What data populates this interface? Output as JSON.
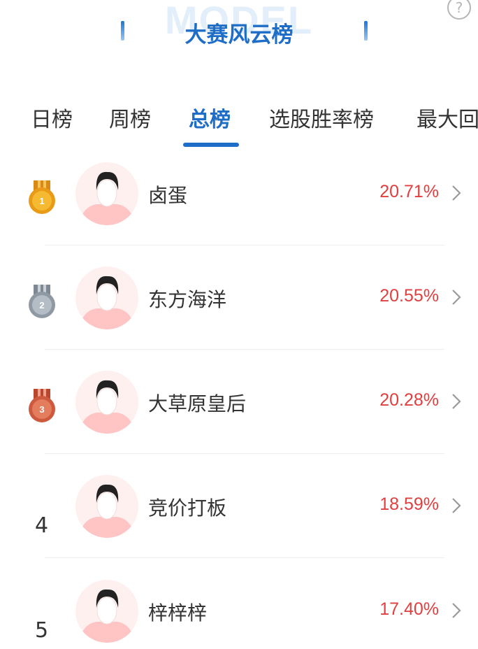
{
  "header": {
    "watermark": "MODEL",
    "title": "大赛风云榜",
    "help_symbol": "?"
  },
  "tabs": [
    {
      "label": "日榜",
      "active": false
    },
    {
      "label": "周榜",
      "active": false
    },
    {
      "label": "总榜",
      "active": true
    },
    {
      "label": "选股胜率榜",
      "active": false
    },
    {
      "label": "最大回",
      "active": false
    }
  ],
  "colors": {
    "accent": "#1e6dc7",
    "gain": "#e03f3f",
    "gold_medal": "#f0a51c",
    "silver_medal": "#9aa3ad",
    "bronze_medal": "#d8674a"
  },
  "ranking": [
    {
      "rank": "1",
      "medal": "gold-medal-icon",
      "name": "卤蛋",
      "return": "20.71%"
    },
    {
      "rank": "2",
      "medal": "silver-medal-icon",
      "name": "东方海洋",
      "return": "20.55%"
    },
    {
      "rank": "3",
      "medal": "bronze-medal-icon",
      "name": "大草原皇后",
      "return": "20.28%"
    },
    {
      "rank": "4",
      "medal": "",
      "name": "竞价打板",
      "return": "18.59%"
    },
    {
      "rank": "5",
      "medal": "",
      "name": "梓梓梓",
      "return": "17.40%"
    }
  ]
}
